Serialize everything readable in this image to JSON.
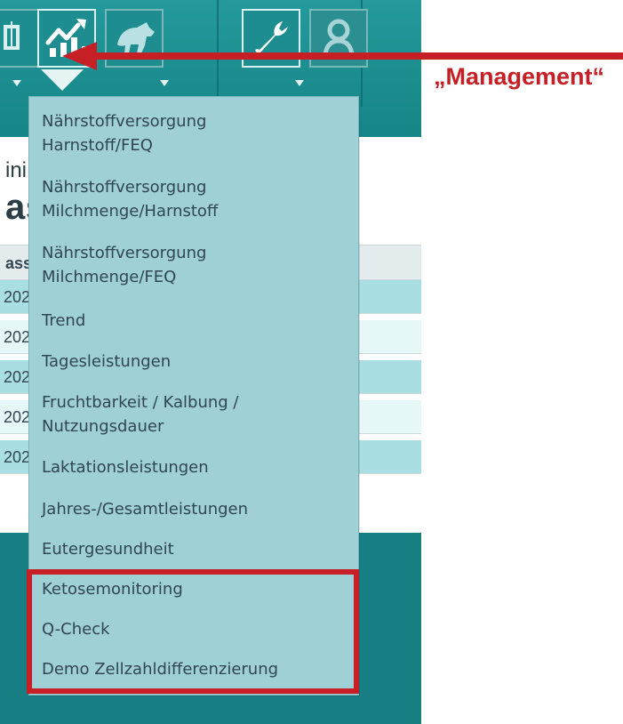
{
  "content": {
    "small_fragment": "ini",
    "large_fragment": "as",
    "header_fragment": "ass",
    "year_fragments": [
      "202",
      "202",
      "202",
      "202",
      "202"
    ]
  },
  "menu": {
    "items": [
      {
        "label": "Nährstoffversorgung\nHarnstoff/FEQ"
      },
      {
        "label": "Nährstoffversorgung\nMilchmenge/Harnstoff"
      },
      {
        "label": "Nährstoffversorgung\nMilchmenge/FEQ"
      },
      {
        "label": "Trend"
      },
      {
        "label": "Tagesleistungen"
      },
      {
        "label": "Fruchtbarkeit / Kalbung /\nNutzungsdauer"
      },
      {
        "label": "Laktationsleistungen"
      },
      {
        "label": "Jahres-/Gesamtleistungen"
      },
      {
        "label": "Eutergesundheit"
      },
      {
        "label": "Ketosemonitoring"
      },
      {
        "label": "Q-Check"
      },
      {
        "label": "Demo Zellzahldifferenzierung"
      }
    ]
  },
  "annotation": {
    "label": "„Management“",
    "color": "#c61f25"
  },
  "icons": {
    "toolbar": [
      "partial-toolbar-icon",
      "management-chart-icon",
      "animal-icon",
      "wrench-icon",
      "user-icon"
    ]
  }
}
